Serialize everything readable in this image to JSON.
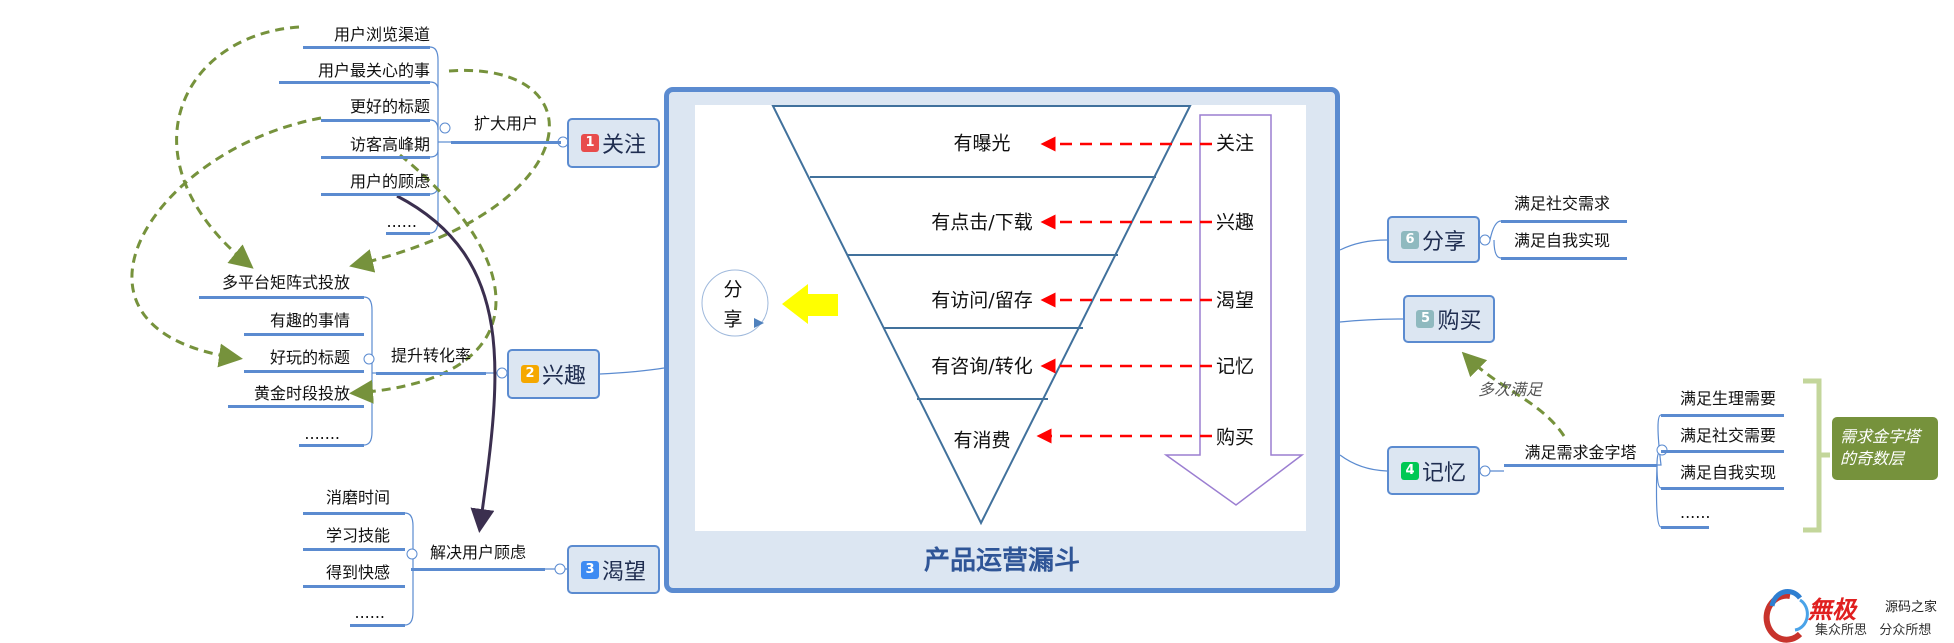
{
  "funnel": {
    "title": "产品运营漏斗",
    "stages": [
      "有曝光",
      "有点击/下载",
      "有访问/留存",
      "有咨询/转化",
      "有消费"
    ],
    "phases": [
      "关注",
      "兴趣",
      "渴望",
      "记忆",
      "购买"
    ],
    "share_circle": [
      "分",
      "享"
    ],
    "colors": {
      "frame": "#5b8bd0",
      "frame_fill": "#dce6f2",
      "funnel_line": "#41719c",
      "arrow_dash": "#ff0000",
      "down_arrow": "#9b7ed1",
      "share_arrow": "#ffff00"
    }
  },
  "left_branches": [
    {
      "badge": "1",
      "badge_color": "#e84c4c",
      "label": "关注",
      "sub": "扩大用户",
      "items": [
        "用户浏览渠道",
        "用户最关心的事",
        "更好的标题",
        "访客高峰期",
        "用户的顾虑",
        "......"
      ]
    },
    {
      "badge": "2",
      "badge_color": "#f5a800",
      "label": "兴趣",
      "sub": "提升转化率",
      "items": [
        "多平台矩阵式投放",
        "有趣的事情",
        "好玩的标题",
        "黄金时段投放",
        "......."
      ]
    },
    {
      "badge": "3",
      "badge_color": "#3d8bf2",
      "label": "渴望",
      "sub": "解决用户顾虑",
      "items": [
        "消磨时间",
        "学习技能",
        "得到快感",
        "......"
      ]
    }
  ],
  "right_branches": [
    {
      "badge": "6",
      "badge_color": "#8fb9bf",
      "label": "分享",
      "items": [
        "满足社交需求",
        "满足自我实现"
      ]
    },
    {
      "badge": "5",
      "badge_color": "#8fb9bf",
      "label": "购买"
    },
    {
      "badge": "4",
      "badge_color": "#00c853",
      "label": "记忆",
      "sub": "满足需求金字塔",
      "items": [
        "满足生理需要",
        "满足社交需要",
        "满足自我实现",
        "......"
      ]
    }
  ],
  "relation_label": "多次满足",
  "summary_label": [
    "需求金字塔",
    "的奇数层"
  ],
  "summary_color": "#76923c",
  "dashed_link_color": "#76923c",
  "logo": {
    "brand": "無极",
    "name": "源码之家",
    "slogan": "集众所思   分众所想"
  }
}
